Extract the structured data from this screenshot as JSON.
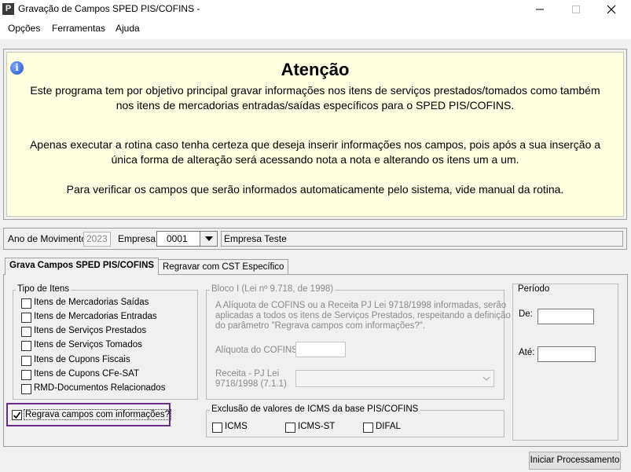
{
  "window": {
    "title": "Gravação de Campos SPED PIS/COFINS -",
    "app_icon": "P"
  },
  "menu": [
    "Opções",
    "Ferramentas",
    "Ajuda"
  ],
  "attention": {
    "title": "Atenção",
    "para1_line1": "Este programa tem por objetivo principal gravar informações nos itens de serviços prestados/tomados como também",
    "para1_line2": "nos itens de mercadorias entradas/saídas específicos para o SPED PIS/COFINS.",
    "para2_line1": "Apenas executar a rotina caso tenha certeza que deseja inserir informações nos campos, pois após a sua inserção a",
    "para2_line2": "única forma de alteração será acessando nota a nota e alterando os itens um a um.",
    "para3": "Para verificar os campos que serão informados automaticamente pelo sistema, vide manual da rotina."
  },
  "movimento": {
    "ano_label": "Ano de Movimento:",
    "ano_value": "2023",
    "empresa_label": "Empresa:",
    "empresa_code": "0001",
    "empresa_name": "Empresa Teste"
  },
  "tabs": [
    "Grava Campos SPED PIS/COFINS",
    "Regravar com CST Específico"
  ],
  "tipo_itens": {
    "title": "Tipo de Itens",
    "items": [
      "Itens de Mercadorias Saídas",
      "Itens de Mercadorias Entradas",
      "Itens de Serviços Prestados",
      "Itens de Serviços Tomados",
      "Itens de Cupons Fiscais",
      "Itens de Cupons CFe-SAT",
      "RMD-Documentos Relacionados"
    ]
  },
  "regrava": {
    "label": "Regrava campos com informações?",
    "checked": true
  },
  "bloco": {
    "title": "Bloco I (Lei nº 9.718, de 1998)",
    "desc_line1": "A Alíquota de COFINS ou a Receita PJ Lei 9718/1998 informadas, serão",
    "desc_line2": "aplicadas a todos os itens de Serviços Prestados, respeitando a definição",
    "desc_line3": "do parâmetro \"Regrava campos com informações?\".",
    "aliquota_label": "Alíquota do COFINS",
    "receita_line1": "Receita - PJ Lei",
    "receita_line2": "9718/1998 (7.1.1)"
  },
  "exclusao": {
    "title": "Exclusão de valores de ICMS da base PIS/COFINS",
    "items": [
      "ICMS",
      "ICMS-ST",
      "DIFAL"
    ]
  },
  "periodo": {
    "title": "Período",
    "de_label": "De:",
    "ate_label": "Até:"
  },
  "actions": {
    "iniciar": "Iniciar Processamento"
  },
  "colors": {
    "attention_bg": "#ffffe1",
    "highlight_border": "#6b2a8c"
  }
}
